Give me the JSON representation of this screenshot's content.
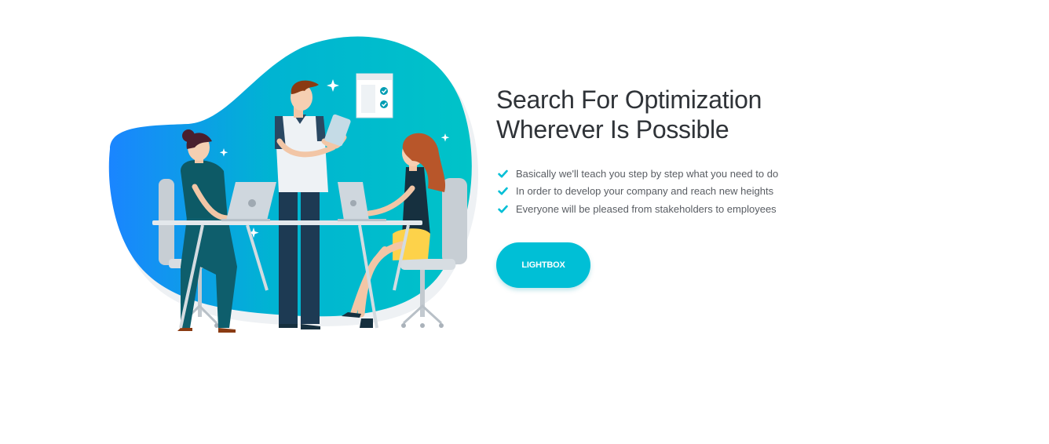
{
  "hero": {
    "title_line1": "Search For Optimization",
    "title_line2": "Wherever Is Possible",
    "features": [
      "Basically we'll teach you step by step what you need to do",
      "In order to develop your company and reach new heights",
      "Everyone will be pleased from stakeholders to employees"
    ],
    "cta_label": "LIGHTBOX"
  },
  "illustration": {
    "description_icon": "team-meeting-illustration"
  },
  "colors": {
    "accent": "#00bfd6",
    "blob_gradient_start": "#1a85ff",
    "blob_gradient_end": "#00c3c8",
    "title": "#2f3338",
    "text": "#595d63"
  }
}
